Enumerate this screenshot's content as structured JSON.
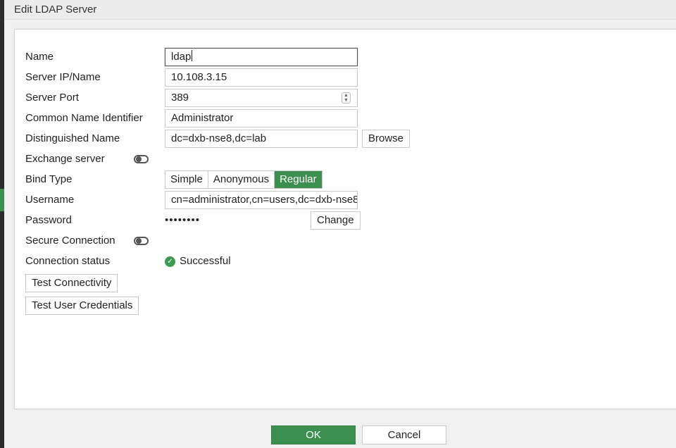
{
  "window": {
    "title": "Edit LDAP Server"
  },
  "form": {
    "name": {
      "label": "Name",
      "value": "ldap"
    },
    "server": {
      "label": "Server IP/Name",
      "value": "10.108.3.15"
    },
    "port": {
      "label": "Server Port",
      "value": "389"
    },
    "cn_identifier": {
      "label": "Common Name Identifier",
      "value": "Administrator"
    },
    "dn": {
      "label": "Distinguished Name",
      "value": "dc=dxb-nse8,dc=lab",
      "browse_label": "Browse"
    },
    "exchange": {
      "label": "Exchange server",
      "enabled": false
    },
    "bind_type": {
      "label": "Bind Type",
      "options": [
        "Simple",
        "Anonymous",
        "Regular"
      ],
      "selected": "Regular"
    },
    "username": {
      "label": "Username",
      "value": "cn=administrator,cn=users,dc=dxb-nse8"
    },
    "password": {
      "label": "Password",
      "masked": "••••••••",
      "change_label": "Change"
    },
    "secure": {
      "label": "Secure Connection",
      "enabled": false
    },
    "status": {
      "label": "Connection status",
      "value": "Successful"
    },
    "test_connectivity": "Test Connectivity",
    "test_credentials": "Test User Credentials"
  },
  "footer": {
    "ok_label": "OK",
    "cancel_label": "Cancel"
  },
  "colors": {
    "accent": "#3d8f4f",
    "success": "#3d9a52"
  },
  "icons": {
    "status": "check-circle-icon",
    "spinner": "spinner-icon"
  }
}
